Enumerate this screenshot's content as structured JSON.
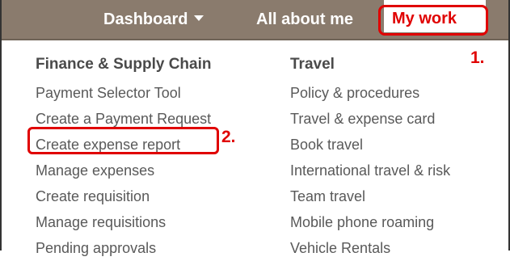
{
  "nav": {
    "dashboard": "Dashboard",
    "about": "All about me",
    "mywork": "My work"
  },
  "annotations": {
    "step1": "1.",
    "step2": "2."
  },
  "finance": {
    "title": "Finance & Supply Chain",
    "items": [
      "Payment Selector Tool",
      "Create a Payment Request",
      "Create expense report",
      "Manage expenses",
      "Create requisition",
      "Manage requisitions",
      "Pending approvals"
    ]
  },
  "travel": {
    "title": "Travel",
    "items": [
      "Policy & procedures",
      "Travel & expense card",
      "Book travel",
      "International travel & risk",
      "Team travel",
      "Mobile phone roaming",
      "Vehicle Rentals"
    ]
  },
  "colors": {
    "navbar": "#8a7b6d",
    "highlight": "#e00000",
    "text": "#595959"
  },
  "icons": {
    "dashboard_caret": "caret-down-icon"
  }
}
